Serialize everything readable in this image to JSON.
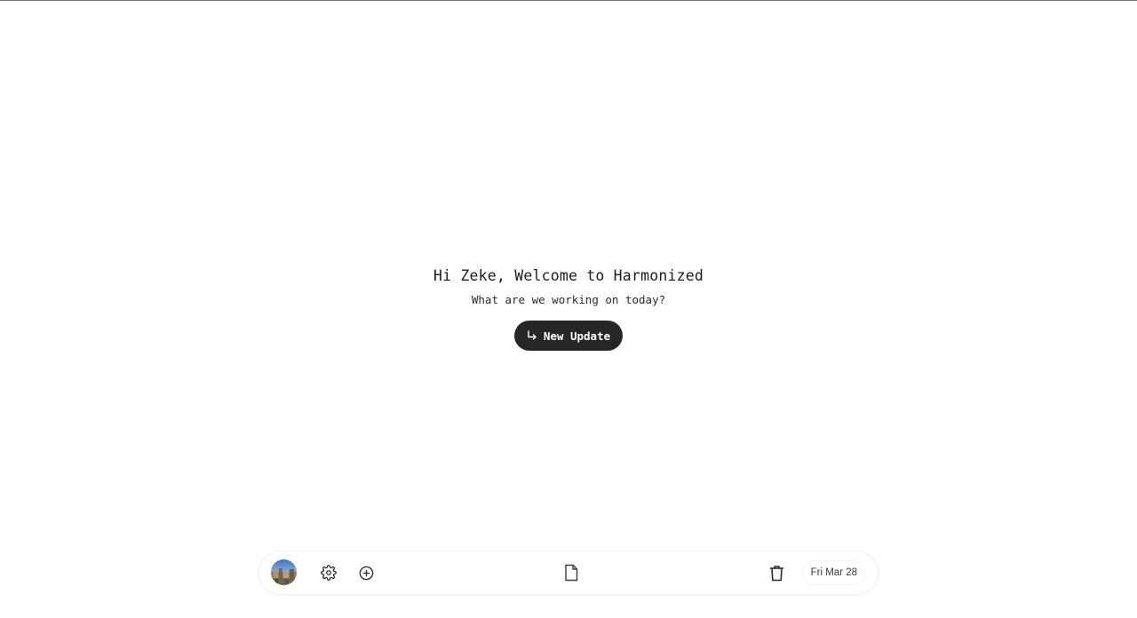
{
  "welcome": {
    "title": "Hi Zeke, Welcome to Harmonized",
    "subtitle": "What are we working on today?",
    "new_update_label": "New Update",
    "new_update_icon": "return-arrow-icon"
  },
  "toolbar": {
    "avatar": "user-avatar",
    "settings_icon": "gear-icon",
    "add_icon": "plus-circle-icon",
    "document_icon": "document-icon",
    "delete_icon": "trash-icon",
    "date_label": "Fri Mar 28"
  },
  "colors": {
    "button_bg": "#262626",
    "button_text": "#ffffff",
    "text_primary": "#1b1b1b",
    "toolbar_border": "#f1f1f1"
  }
}
